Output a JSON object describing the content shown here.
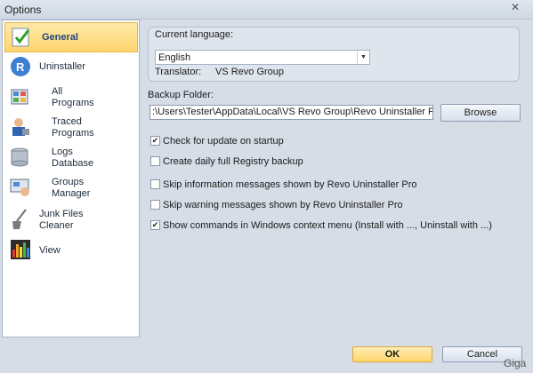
{
  "window": {
    "title": "Options",
    "close_glyph": "✕"
  },
  "sidebar": {
    "items": [
      {
        "label": "General",
        "icon": "checkmark-document-icon"
      },
      {
        "label": "Uninstaller",
        "icon": "revo-uninstaller-icon"
      },
      {
        "label": "All Programs",
        "icon": "all-programs-icon"
      },
      {
        "label": "Traced Programs",
        "icon": "traced-programs-icon"
      },
      {
        "label": "Logs Database",
        "icon": "database-icon"
      },
      {
        "label": "Groups Manager",
        "icon": "groups-manager-icon"
      },
      {
        "label": "Junk Files Cleaner",
        "icon": "broom-icon"
      },
      {
        "label": "View",
        "icon": "equalizer-icon"
      }
    ]
  },
  "language": {
    "group_label": "Current language:",
    "selected": "English",
    "translator_label": "Translator:",
    "translator_value": "VS Revo Group"
  },
  "backup": {
    "label": "Backup Folder:",
    "path": ":\\Users\\Tester\\AppData\\Local\\VS Revo Group\\Revo Uninstaller Pro\\BackUp",
    "browse_label": "Browse"
  },
  "options": [
    {
      "label": "Check for update on startup",
      "checked": true
    },
    {
      "label": "Create daily full Registry backup",
      "checked": false
    },
    {
      "label": "Skip information messages shown by Revo Uninstaller Pro",
      "checked": false
    },
    {
      "label": "Skip warning messages shown by Revo Uninstaller Pro",
      "checked": false
    },
    {
      "label": "Show commands in Windows context menu (Install with ..., Uninstall with ...)",
      "checked": true
    }
  ],
  "footer": {
    "ok_label": "OK",
    "cancel_label": "Cancel",
    "watermark": "Giga"
  },
  "colors": {
    "selection": "#ffd66e",
    "window_bg": "#d6dde7",
    "accent_text": "#21467c"
  }
}
